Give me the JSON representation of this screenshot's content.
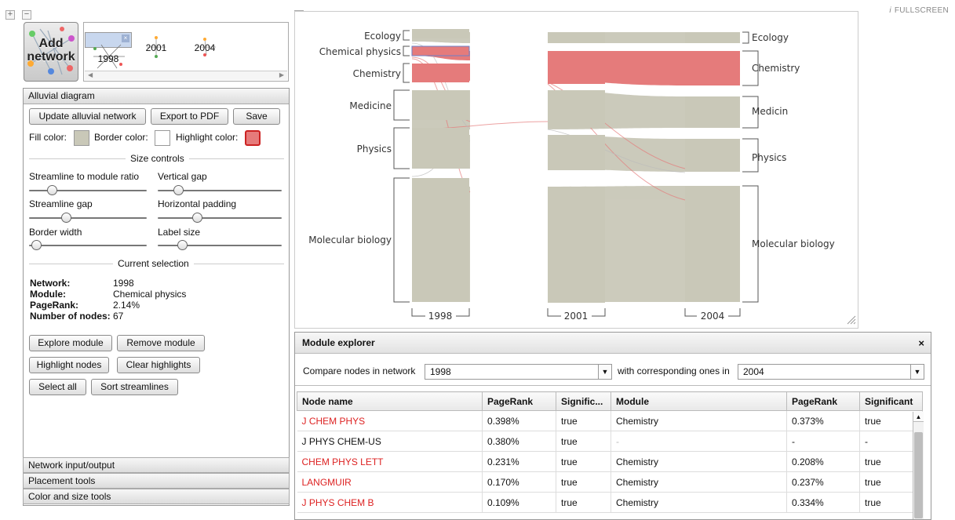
{
  "window": {
    "fullscreen_label": "FULLSCREEN",
    "fullscreen_icon": "i"
  },
  "top_controls": {
    "expand": "+",
    "collapse": "−",
    "diagram_collapse": "−"
  },
  "add_network": {
    "label": "Add network"
  },
  "thumbnails": [
    {
      "year": "1998",
      "selected": true
    },
    {
      "year": "2001"
    },
    {
      "year": "2004"
    }
  ],
  "alluvial_panel": {
    "title": "Alluvial diagram",
    "buttons": {
      "update": "Update alluvial network",
      "export": "Export to PDF",
      "save": "Save"
    },
    "colors": {
      "fill_label": "Fill color:",
      "fill": "#c9c8b8",
      "border_label": "Border color:",
      "border": "#ffffff",
      "highlight_label": "Highlight color:",
      "highlight": "#e67b7b"
    },
    "size_controls_title": "Size controls",
    "sliders": [
      {
        "label": "Streamline to module ratio",
        "value": 0.17
      },
      {
        "label": "Vertical gap",
        "value": 0.14
      },
      {
        "label": "Streamline gap",
        "value": 0.3
      },
      {
        "label": "Horizontal padding",
        "value": 0.3
      },
      {
        "label": "Border width",
        "value": 0.02
      },
      {
        "label": "Label size",
        "value": 0.17
      }
    ],
    "current_selection_title": "Current selection",
    "selection": {
      "network_key": "Network:",
      "network": "1998",
      "module_key": "Module:",
      "module": "Chemical physics",
      "pagerank_key": "PageRank:",
      "pagerank": "2.14%",
      "nodes_key": "Number of nodes:",
      "nodes": "67"
    },
    "action_buttons": {
      "explore": "Explore module",
      "remove": "Remove module",
      "highlight": "Highlight nodes",
      "clear": "Clear highlights",
      "select_all": "Select all",
      "sort": "Sort streamlines"
    }
  },
  "accordion": {
    "network_io": "Network input/output",
    "placement": "Placement tools",
    "color_size": "Color and size tools"
  },
  "diagram": {
    "left_labels": [
      "Ecology",
      "Chemical physics",
      "Chemistry",
      "Medicine",
      "Physics",
      "Molecular biology"
    ],
    "right_labels": [
      "Ecology",
      "Chemistry",
      "Medicin",
      "Physics",
      "Molecular biology"
    ],
    "years": [
      "1998",
      "2001",
      "2004"
    ],
    "fill_color": "#c9c8b8",
    "highlight_color": "#e57b7b"
  },
  "explorer": {
    "title": "Module explorer",
    "close": "×",
    "compare_label": "Compare nodes in network",
    "network_a": "1998",
    "corresponding_label": "with corresponding ones in",
    "network_b": "2004",
    "columns": [
      "Node name",
      "PageRank",
      "Signific...",
      "Module",
      "PageRank",
      "Significant"
    ],
    "rows": [
      {
        "name": "J CHEM PHYS",
        "pr": "0.398%",
        "sig": "true",
        "module": "Chemistry",
        "pr2": "0.373%",
        "sig2": "true",
        "hl": true
      },
      {
        "name": "J PHYS CHEM-US",
        "pr": "0.380%",
        "sig": "true",
        "module": "-",
        "pr2": "-",
        "sig2": "-",
        "hl": false
      },
      {
        "name": "CHEM PHYS LETT",
        "pr": "0.231%",
        "sig": "true",
        "module": "Chemistry",
        "pr2": "0.208%",
        "sig2": "true",
        "hl": true
      },
      {
        "name": "LANGMUIR",
        "pr": "0.170%",
        "sig": "true",
        "module": "Chemistry",
        "pr2": "0.237%",
        "sig2": "true",
        "hl": true
      },
      {
        "name": "J PHYS CHEM B",
        "pr": "0.109%",
        "sig": "true",
        "module": "Chemistry",
        "pr2": "0.334%",
        "sig2": "true",
        "hl": true
      }
    ]
  }
}
